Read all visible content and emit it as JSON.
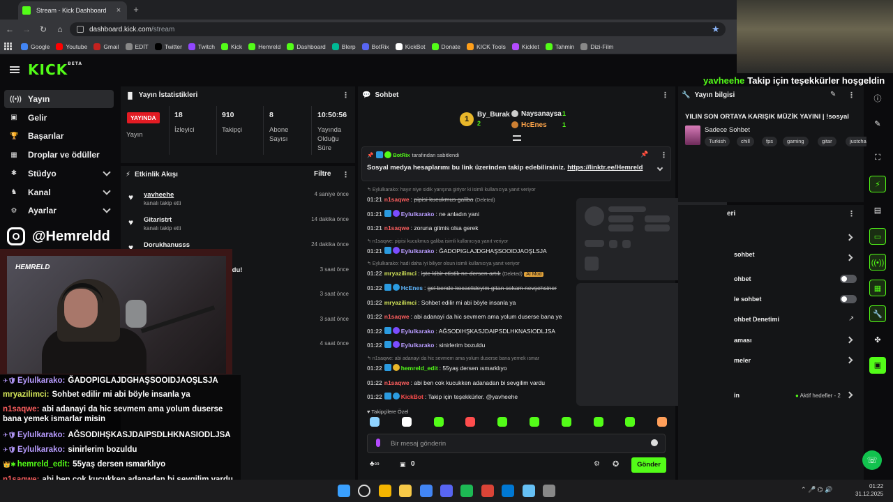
{
  "browser": {
    "tab_title": "Stream - Kick Dashboard",
    "url_domain": "dashboard.kick.com",
    "url_path": "/stream",
    "bookmarks": [
      "Google",
      "Youtube",
      "Gmail",
      "EDİT",
      "Twitter",
      "Twitch",
      "Kick",
      "Hemreld",
      "Dashboard",
      "Blerp",
      "BotRix",
      "KickBot",
      "Donate",
      "KICK Tools",
      "Kicklet",
      "Tahmin",
      "Dizi-Film"
    ]
  },
  "nav": {
    "logo": "KICK",
    "logo_sup": "BETA",
    "items": [
      {
        "label": "Yayın",
        "icon": "broadcast-icon"
      },
      {
        "label": "Gelir",
        "icon": "revenue-icon"
      },
      {
        "label": "Başarılar",
        "icon": "trophy-icon"
      },
      {
        "label": "Droplar ve ödüller",
        "icon": "gift-icon"
      },
      {
        "label": "Stüdyo",
        "icon": "studio-icon"
      },
      {
        "label": "Kanal",
        "icon": "channel-icon"
      },
      {
        "label": "Ayarlar",
        "icon": "gear-icon"
      }
    ]
  },
  "instagram_handle": "@Hemreldd",
  "stats": {
    "title": "Yayın İstatistikleri",
    "live_badge": "YAYINDA",
    "live_caption": "Yayın",
    "items": [
      {
        "value": "18",
        "label": "İzleyici"
      },
      {
        "value": "910",
        "label": "Takipçi"
      },
      {
        "value": "8",
        "label": "Abone Sayısı"
      },
      {
        "value": "10:50:56",
        "label": "Yayında Olduğu Süre"
      }
    ]
  },
  "activity": {
    "title": "Etkinlik Akışı",
    "filter": "Filtre",
    "items": [
      {
        "user": "yavheehe",
        "sub": "kanalı takip etti",
        "time": "4 saniye önce"
      },
      {
        "user": "Gitaristrt",
        "sub": "kanalı takip etti",
        "time": "14 dakika önce"
      },
      {
        "user": "Dorukhanusss",
        "sub": "",
        "time": "24 dakika önce"
      },
      {
        "user": "",
        "sub": "",
        "time": "3 saat önce"
      },
      {
        "user": "",
        "sub": "",
        "time": "3 saat önce"
      },
      {
        "user": "",
        "sub": "",
        "time": "3 saat önce"
      },
      {
        "user": "",
        "sub": "",
        "time": "4 saat önce"
      }
    ],
    "partial_label": "ldu!"
  },
  "chat": {
    "title": "Sohbet",
    "leaders": [
      {
        "rank": "1",
        "name": "By_Burak",
        "count": "2"
      },
      {
        "name": "Naysanaysa",
        "count": "1"
      },
      {
        "name": "HcEnes",
        "count": "1"
      }
    ],
    "pinned_by": "BotRix",
    "pinned_suffix": "tarafından sabitlendi",
    "pinned_text": "Sosyal medya hesaplarımı bu link üzerinden takip edebilirsiniz.",
    "pinned_link": "https://linktr.ee/Hemreld",
    "lines": [
      {
        "type": "reply",
        "text": "Eylulkarako: hayır niye sidik yarışına giriyor ki isimli kullanıcıya yanıt veriyor"
      },
      {
        "type": "msg",
        "time": "01:21",
        "user": "n1saqwe",
        "color": "#ff5f5f",
        "text": "pipisi kucukmus galiba",
        "strike": true,
        "extra": "(Deleted)"
      },
      {
        "type": "msg",
        "time": "01:21",
        "user": "Eylulkarako",
        "color": "#b89cff",
        "text": "ne anladın yani"
      },
      {
        "type": "msg",
        "time": "01:21",
        "user": "n1saqwe",
        "color": "#ff5f5f",
        "text": "zoruna gitmis olsa gerek"
      },
      {
        "type": "reply",
        "text": "n1saqwe: pipisi kucukmus galiba isimli kullanıcıya yanıt veriyor"
      },
      {
        "type": "msg",
        "time": "01:21",
        "user": "Eylulkarako",
        "color": "#b89cff",
        "text": "ĞADOPIGLAJDGHAŞSOOIDJAOŞLSJA"
      },
      {
        "type": "reply",
        "text": "Eylulkarako: hadi daha iyi biliyor olsun isimli kullanıcıya yanıt veriyor"
      },
      {
        "type": "msg",
        "time": "01:22",
        "user": "mryazilimci",
        "color": "#d6e85a",
        "text": "işte kibir ctistik ne dersen artık",
        "strike": true,
        "extra": "(Deleted)",
        "badge": "AI Mod"
      },
      {
        "type": "msg",
        "time": "01:22",
        "user": "HcEnes",
        "color": "#5fb7ff",
        "text": "gel bende kocaelideyim gitan sokam nevşehsiner",
        "strike": true
      },
      {
        "type": "msg",
        "time": "01:22",
        "user": "mryazilimci",
        "color": "#d6e85a",
        "text": "Sohbet edilir mi abi böyle insanla ya"
      },
      {
        "type": "msg",
        "time": "01:22",
        "user": "n1saqwe",
        "color": "#ff5f5f",
        "text": "abi adanayi da hic sevmem ama yolum duserse bana ye"
      },
      {
        "type": "msg",
        "time": "01:22",
        "user": "Eylulkarako",
        "color": "#b89cff",
        "text": "AĞSODIHŞKASJDAIPSDLHKNASIODLJSA"
      },
      {
        "type": "msg",
        "time": "01:22",
        "user": "Eylulkarako",
        "color": "#b89cff",
        "text": "sinirlerim bozuldu"
      },
      {
        "type": "reply",
        "text": "n1saqwe: abi adanayi da hic sevmem ama yolum duserse bana yemek ısmar"
      },
      {
        "type": "msg",
        "time": "01:22",
        "user": "hemreld_edit",
        "color": "#53fc18",
        "text": "55yaş dersen ısmarklıyo"
      },
      {
        "type": "msg",
        "time": "01:22",
        "user": "n1saqwe",
        "color": "#ff5f5f",
        "text": "abi ben cok kucukken adanadan bi sevgilim vardu"
      },
      {
        "type": "msg",
        "time": "01:22",
        "user": "KickBot",
        "color": "#ff4d4d",
        "text": "Takip için teşekkürler. @yavheehe"
      }
    ],
    "followers_only": "Takipçilere Özel",
    "input_placeholder": "Bir mesaj gönderin",
    "points": "0",
    "send": "Gönder"
  },
  "info": {
    "title": "Yayın bilgisi",
    "stream_title": "YILIN SON ORTAYA KARIŞIK MÜZİK YAYINI | !sosyal",
    "category": "Sadece Sohbet",
    "tags": [
      "Turkish",
      "chill",
      "fps",
      "gaming",
      "gitar",
      "justcha"
    ],
    "panel2_title": "eri",
    "rows": [
      "sohbet",
      "ohbet",
      "le sohbet",
      "ohbet Denetimi",
      "aması",
      "meler",
      "in"
    ],
    "goals": "Aktif hedefler - 2"
  },
  "overlay": {
    "top_user": "yavheehe",
    "top_text": "Takip için teşekkürler hoşgeldin",
    "chat": [
      {
        "user": "Eylulkarako:",
        "color": "#b89cff",
        "text": "ĞADOPIGLAJDGHAŞSOOIDJAOŞLSJA"
      },
      {
        "user": "mryazilimci:",
        "color": "#d6e85a",
        "text": "Sohbet edilir mi abi böyle insanla ya"
      },
      {
        "user": "n1saqwe:",
        "color": "#ff5f5f",
        "text": "abi adanayi da hic sevmem ama yolum duserse bana yemek ismarlar misin"
      },
      {
        "user": "Eylulkarako:",
        "color": "#b89cff",
        "text": "AĞSODIHŞKASJDAIPSDLHKNASIODLJSA"
      },
      {
        "user": "Eylulkarako:",
        "color": "#b89cff",
        "text": "sinirlerim bozuldu"
      },
      {
        "user": "hemreld_edit:",
        "color": "#53fc18",
        "text": "55yaş dersen ısmarklıyo"
      },
      {
        "user": "n1saqwe:",
        "color": "#ff5f5f",
        "text": "abi ben cok kucukken adanadan bi sevgilim vardu"
      },
      {
        "user": "KickBot:",
        "color": "#ff4d4d",
        "text": "Takip için teşekkürler. @yavheehe"
      }
    ],
    "cam_logo": "HEMRELD"
  },
  "taskbar": {
    "time": "01:22",
    "date": "31.12.2025"
  },
  "colors": {
    "accent": "#53fc18",
    "live": "#e31b23",
    "bg": "#0b0b0d",
    "panel": "#141517"
  }
}
